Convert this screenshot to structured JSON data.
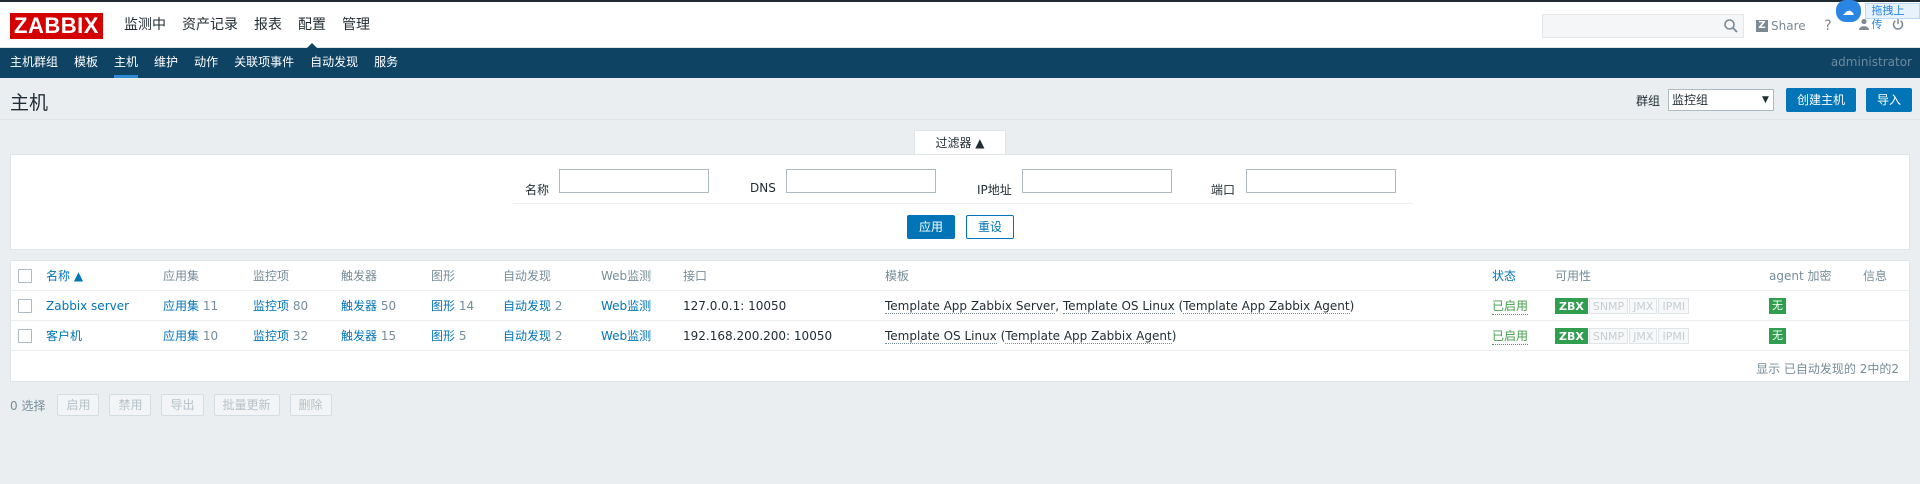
{
  "brand": {
    "logo": "ZABBIX",
    "color": "#d40000"
  },
  "main_menu": [
    "监测中",
    "资产记录",
    "报表",
    "配置",
    "管理"
  ],
  "main_menu_active": "配置",
  "header_right": {
    "share": "Share",
    "help": "?",
    "upload_badge": "拖拽上传"
  },
  "sub_menu": [
    "主机群组",
    "模板",
    "主机",
    "维护",
    "动作",
    "关联项事件",
    "自动发现",
    "服务"
  ],
  "sub_menu_active": "主机",
  "user": "administrator",
  "page": {
    "title": "主机",
    "group_label": "群组",
    "group_value": "监控组",
    "create_button": "创建主机",
    "import_button": "导入"
  },
  "filter": {
    "tab_label": "过滤器 ▲",
    "fields": {
      "name": "名称",
      "dns": "DNS",
      "ip": "IP地址",
      "port": "端口"
    },
    "apply": "应用",
    "reset": "重设"
  },
  "table": {
    "headers": {
      "name": "名称 ▲",
      "apps": "应用集",
      "items": "监控项",
      "triggers": "触发器",
      "graphs": "图形",
      "discovery": "自动发现",
      "web": "Web监测",
      "interface": "接口",
      "templates": "模板",
      "status": "状态",
      "availability": "可用性",
      "encryption": "agent 加密",
      "info": "信息"
    },
    "rows": [
      {
        "name": "Zabbix server",
        "apps_label": "应用集",
        "apps_count": "11",
        "items_label": "监控项",
        "items_count": "80",
        "triggers_label": "触发器",
        "triggers_count": "50",
        "graphs_label": "图形",
        "graphs_count": "14",
        "discovery_label": "自动发现",
        "discovery_count": "2",
        "web": "Web监测",
        "interface": "127.0.0.1: 10050",
        "tmpl_a": "Template App Zabbix Server",
        "tmpl_sep": ", ",
        "tmpl_b": "Template OS Linux",
        "tmpl_open": " (",
        "tmpl_c": "Template App Zabbix Agent",
        "tmpl_close": ")",
        "status": "已启用",
        "encryption": "无"
      },
      {
        "name": "客户机",
        "apps_label": "应用集",
        "apps_count": "10",
        "items_label": "监控项",
        "items_count": "32",
        "triggers_label": "触发器",
        "triggers_count": "15",
        "graphs_label": "图形",
        "graphs_count": "5",
        "discovery_label": "自动发现",
        "discovery_count": "2",
        "web": "Web监测",
        "interface": "192.168.200.200: 10050",
        "tmpl_b": "Template OS Linux",
        "tmpl_open": " (",
        "tmpl_c": "Template App Zabbix Agent",
        "tmpl_close": ")",
        "status": "已启用",
        "encryption": "无"
      }
    ],
    "availability_tags": [
      "ZBX",
      "SNMP",
      "JMX",
      "IPMI"
    ],
    "footer": "显示 已自动发现的 2中的2"
  },
  "actions": {
    "selected": "0 选择",
    "buttons": [
      "启用",
      "禁用",
      "导出",
      "批量更新",
      "删除"
    ]
  },
  "colors": {
    "nav": "#0e4364",
    "accent": "#0275b8",
    "ok": "#2f9e4f"
  }
}
